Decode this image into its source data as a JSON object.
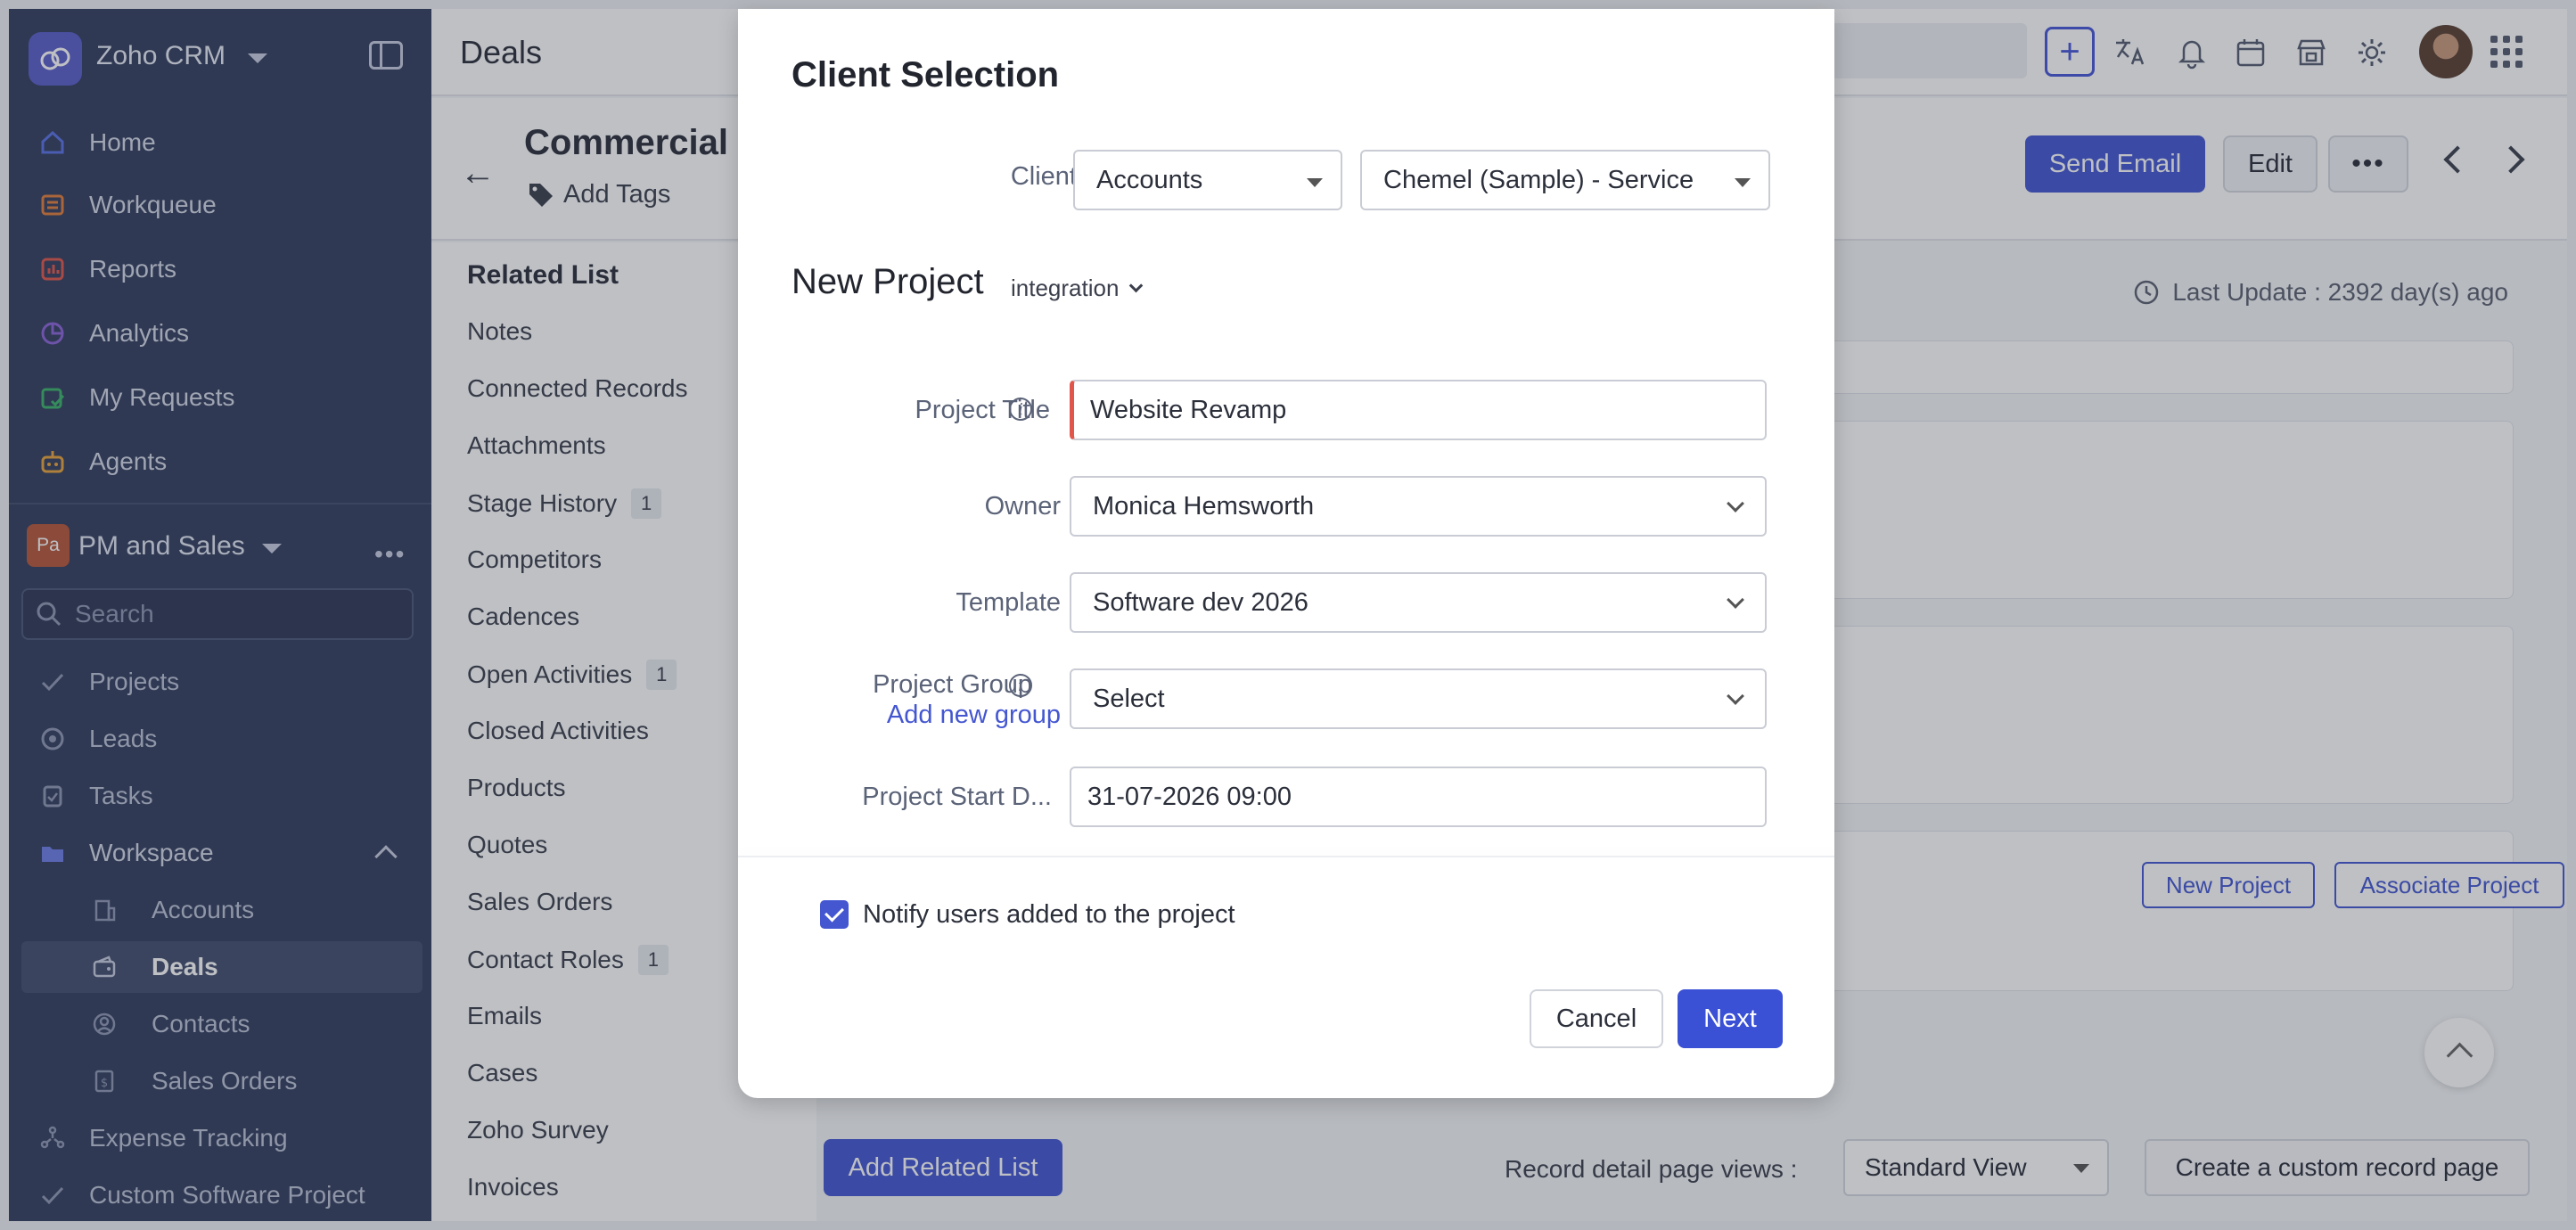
{
  "sidebar": {
    "app_name": "Zoho CRM",
    "nav": [
      {
        "label": "Home",
        "icon": "home-icon",
        "color": "#5a72e6"
      },
      {
        "label": "Workqueue",
        "icon": "workqueue-icon",
        "color": "#e27d3b"
      },
      {
        "label": "Reports",
        "icon": "reports-icon",
        "color": "#e0564b"
      },
      {
        "label": "Analytics",
        "icon": "analytics-icon",
        "color": "#8b63d8"
      },
      {
        "label": "My Requests",
        "icon": "requests-icon",
        "color": "#3bb36b"
      },
      {
        "label": "Agents",
        "icon": "agents-icon",
        "color": "#e8a43b"
      }
    ],
    "workspace_badge": "Pa",
    "workspace_name": "PM and Sales",
    "search_placeholder": "Search",
    "sub_items": [
      {
        "label": "Projects",
        "icon": "projects-icon"
      },
      {
        "label": "Leads",
        "icon": "leads-icon"
      },
      {
        "label": "Tasks",
        "icon": "tasks-icon"
      },
      {
        "label": "Workspace",
        "icon": "folder-icon"
      },
      {
        "label": "Accounts",
        "icon": "accounts-icon"
      },
      {
        "label": "Deals",
        "icon": "deals-icon"
      },
      {
        "label": "Contacts",
        "icon": "contacts-icon"
      },
      {
        "label": "Sales Orders",
        "icon": "sales-orders-icon"
      },
      {
        "label": "Expense Tracking",
        "icon": "expense-icon"
      },
      {
        "label": "Custom Software Project",
        "icon": "custom-project-icon"
      }
    ]
  },
  "header": {
    "title": "Deals"
  },
  "record": {
    "title": "Commercial",
    "add_tags": "Add Tags",
    "send_email": "Send Email",
    "edit": "Edit",
    "more": "•••",
    "last_update": "Last Update : 2392 day(s) ago"
  },
  "related_list": {
    "title": "Related List",
    "items": [
      {
        "label": "Notes",
        "count": ""
      },
      {
        "label": "Connected Records",
        "count": ""
      },
      {
        "label": "Attachments",
        "count": ""
      },
      {
        "label": "Stage History",
        "count": "1"
      },
      {
        "label": "Competitors",
        "count": ""
      },
      {
        "label": "Cadences",
        "count": ""
      },
      {
        "label": "Open Activities",
        "count": "1"
      },
      {
        "label": "Closed Activities",
        "count": ""
      },
      {
        "label": "Products",
        "count": ""
      },
      {
        "label": "Quotes",
        "count": ""
      },
      {
        "label": "Sales Orders",
        "count": ""
      },
      {
        "label": "Contact Roles",
        "count": "1"
      },
      {
        "label": "Emails",
        "count": ""
      },
      {
        "label": "Cases",
        "count": ""
      },
      {
        "label": "Zoho Survey",
        "count": ""
      },
      {
        "label": "Invoices",
        "count": ""
      }
    ]
  },
  "content": {
    "new_project": "New Project",
    "associate_project": "Associate Project",
    "add_related_list": "Add Related List",
    "views_label": "Record detail page views :",
    "standard_view": "Standard View",
    "custom_record_page": "Create a custom record page"
  },
  "modal": {
    "title": "Client Selection",
    "client_label": "Client",
    "client_type": "Accounts",
    "client_value": "Chemel (Sample) - Service",
    "new_project_title": "New Project",
    "integration": "integration",
    "fields": {
      "project_title_label": "Project Title",
      "project_title_value": "Website Revamp",
      "owner_label": "Owner",
      "owner_value": "Monica Hemsworth",
      "template_label": "Template",
      "template_value": "Software dev 2026",
      "group_label": "Project Group",
      "group_value": "Select",
      "add_group": "Add new group",
      "start_label": "Project Start D...",
      "start_value": "31-07-2026 09:00"
    },
    "notify_label": "Notify users added to the project",
    "notify_checked": true,
    "cancel": "Cancel",
    "next": "Next"
  }
}
